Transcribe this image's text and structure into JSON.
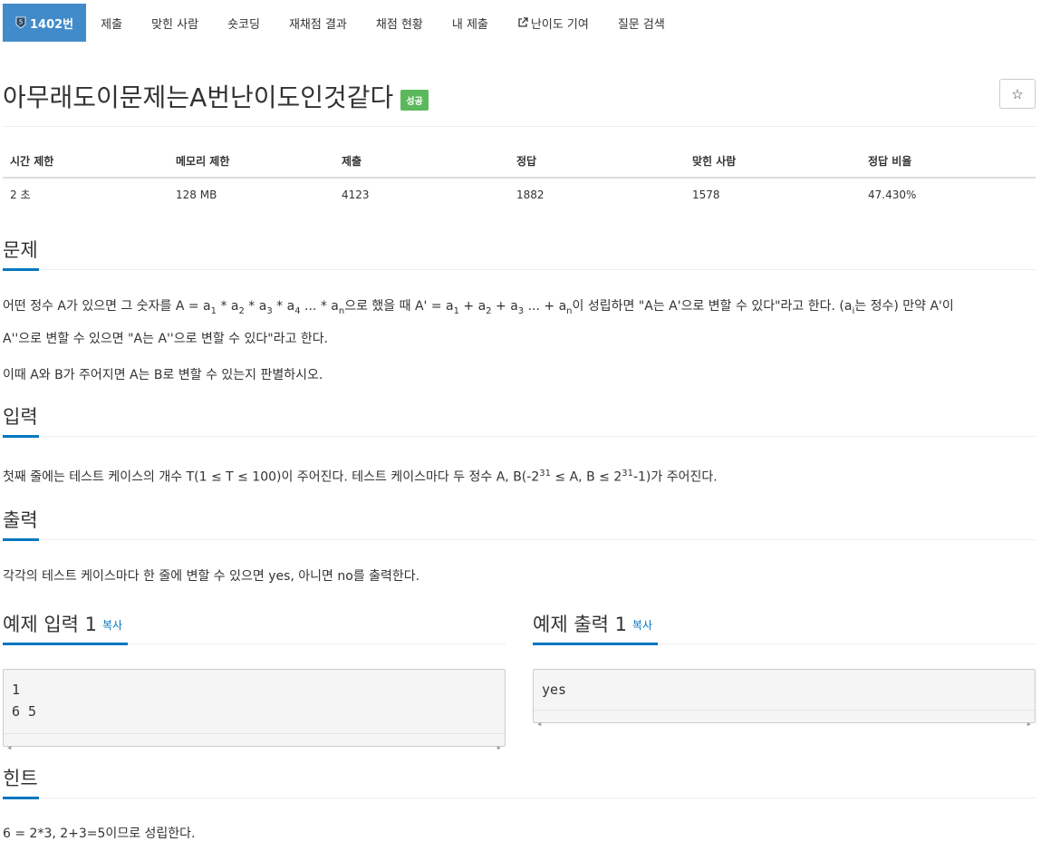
{
  "tabs": [
    {
      "label": "1402번",
      "badge": "5",
      "active": true
    },
    {
      "label": "제출"
    },
    {
      "label": "맞힌 사람"
    },
    {
      "label": "숏코딩"
    },
    {
      "label": "재채점 결과"
    },
    {
      "label": "채점 현황"
    },
    {
      "label": "내 제출"
    },
    {
      "label": "난이도 기여",
      "icon": "external-link-icon"
    },
    {
      "label": "질문 검색"
    }
  ],
  "problem": {
    "title": "아무래도이문제는A번난이도인것같다",
    "result_badge": "성공",
    "star": "☆"
  },
  "info": {
    "headers": [
      "시간 제한",
      "메모리 제한",
      "제출",
      "정답",
      "맞힌 사람",
      "정답 비율"
    ],
    "values": [
      "2 초",
      "128 MB",
      "4123",
      "1882",
      "1578",
      "47.430%"
    ]
  },
  "sections": {
    "problem_title": "문제",
    "input_title": "입력",
    "output_title": "출력",
    "hint_title": "힌트"
  },
  "statement": {
    "p1_a": "어떤 정수 A가 있으면 그 숫자를 A = a",
    "p1_b": " * a",
    "p1_c": " * a",
    "p1_d": " * a",
    "p1_e": " ... * a",
    "p1_f": "으로 했을 때 A' = a",
    "p1_g": " + a",
    "p1_h": " + a",
    "p1_i": " ... + a",
    "p1_j": "이 성립하면 \"A는 A'으로 변할 수 있다\"라고 한다. (a",
    "p1_k": "는 정수) 만약 A'이",
    "p1_l": "A''으로 변할 수 있으면 \"A는 A''으로 변할 수 있다\"라고 한다.",
    "sub1": "1",
    "sub2": "2",
    "sub3": "3",
    "sub4": "4",
    "subn": "n",
    "subi": "i",
    "p2": "이때 A와 B가 주어지면 A는 B로 변할 수 있는지 판별하시오."
  },
  "input_desc": {
    "a": "첫째 줄에는 테스트 케이스의 개수 T(1 ≤ T ≤ 100)이 주어진다. 테스트 케이스마다 두 정수 A, B(-2",
    "sup1": "31",
    "b": " ≤ A, B ≤ 2",
    "sup2": "31",
    "c": "-1)가 주어진다."
  },
  "output_desc": "각각의 테스트 케이스마다 한 줄에 변할 수 있으면 yes, 아니면 no를 출력한다.",
  "sample_input": {
    "title": "예제 입력 1",
    "copy": "복사",
    "lines": "1\n6 5"
  },
  "sample_output": {
    "title": "예제 출력 1",
    "copy": "복사",
    "lines": "yes"
  },
  "hint": "6 = 2*3, 2+3=5이므로 성립한다."
}
